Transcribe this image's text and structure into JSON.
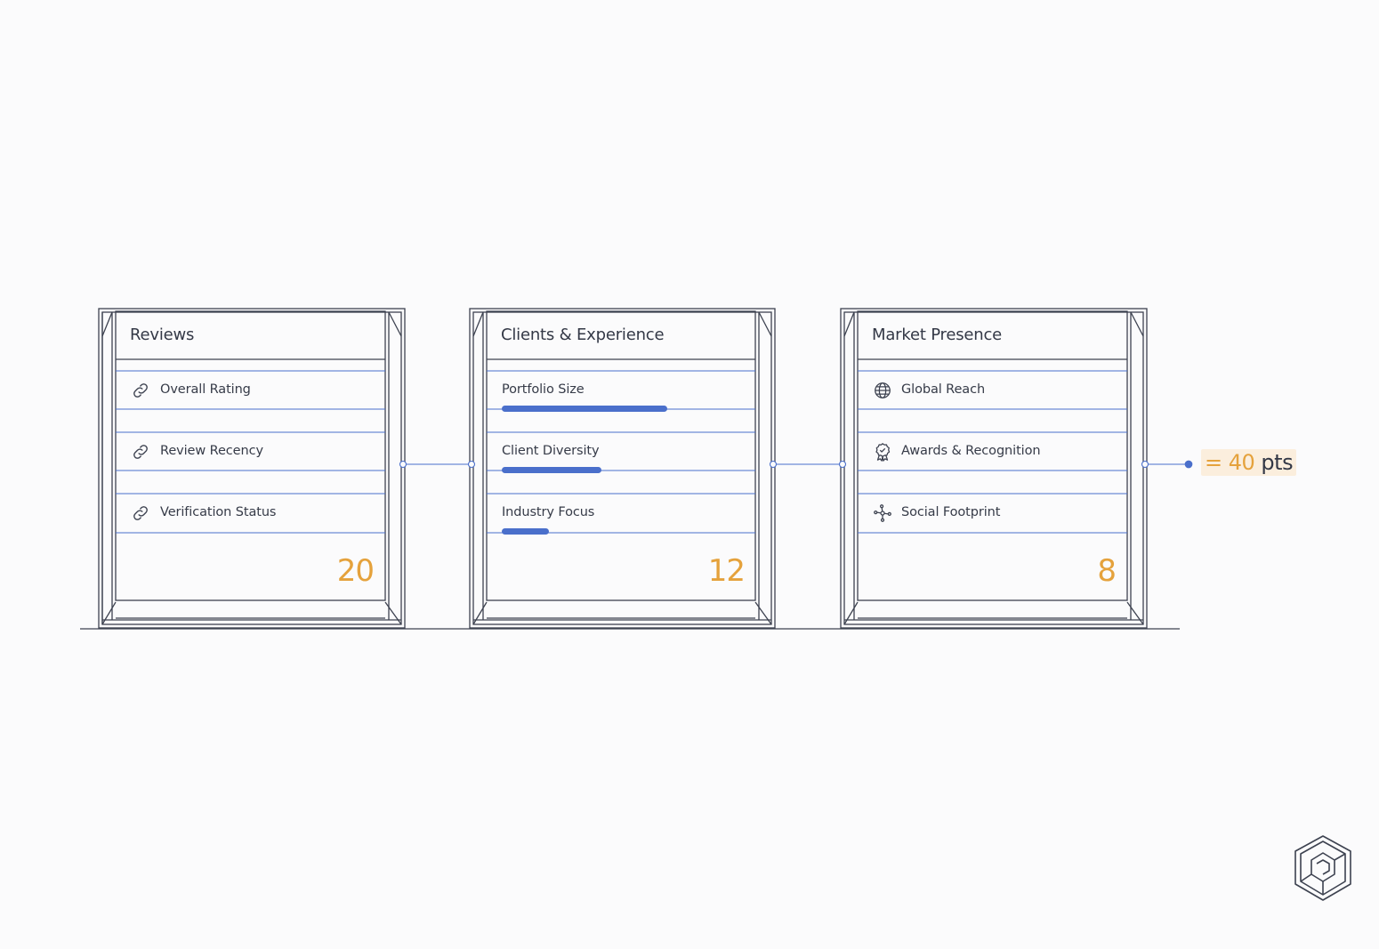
{
  "cards": [
    {
      "title": "Reviews",
      "score": "20",
      "rows": [
        {
          "label": "Overall Rating",
          "icon": "link-icon"
        },
        {
          "label": "Review Recency",
          "icon": "link-icon"
        },
        {
          "label": "Verification Status",
          "icon": "link-icon"
        }
      ]
    },
    {
      "title": "Clients & Experience",
      "score": "12",
      "rows": [
        {
          "label": "Portfolio Size",
          "bar_level": 0.6
        },
        {
          "label": "Client Diversity",
          "bar_level": 0.36
        },
        {
          "label": "Industry Focus",
          "bar_level": 0.17
        }
      ]
    },
    {
      "title": "Market Presence",
      "score": "8",
      "rows": [
        {
          "label": "Global Reach",
          "icon": "globe-icon"
        },
        {
          "label": "Awards & Recognition",
          "icon": "award-ribbon-icon"
        },
        {
          "label": "Social Footprint",
          "icon": "share-nodes-icon"
        }
      ]
    }
  ],
  "total": {
    "prefix": "= 40",
    "unit": "pts"
  },
  "colors": {
    "accent": "#e5a23c",
    "line_blue": "#4a6fcb",
    "frame": "#3d4250"
  },
  "logo_icon": "cube-logo-icon"
}
